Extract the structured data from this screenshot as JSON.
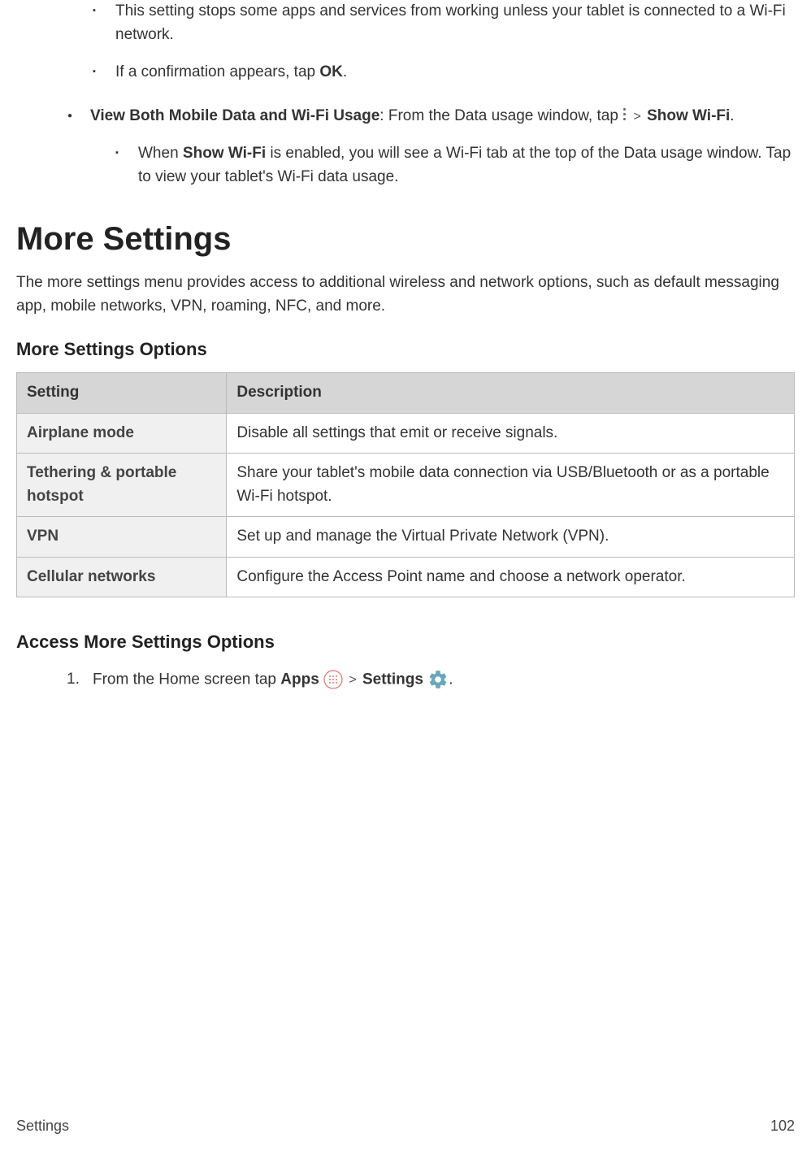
{
  "intro_sub_bullets": [
    "This setting stops some apps and services from working unless your tablet is connected to a Wi-Fi network.",
    "If a confirmation appears, tap "
  ],
  "ok_label": "OK",
  "view_both": {
    "lead_bold": "View Both Mobile Data and Wi-Fi Usage",
    "lead_rest": ": From the Data usage window, tap ",
    "gt": ">",
    "show_wifi": "Show Wi-Fi",
    "sub": "When ",
    "sub_bold": "Show Wi-Fi",
    "sub_rest": " is enabled, you will see a Wi-Fi tab at the top of the Data usage window. Tap to view your tablet's Wi-Fi data usage."
  },
  "h1": "More Settings",
  "intro_para": "The more settings menu provides access to additional wireless and network options, such as default messaging app, mobile networks, VPN, roaming, NFC, and more.",
  "h2_options": "More Settings Options",
  "table": {
    "headers": [
      "Setting",
      "Description"
    ],
    "rows": [
      [
        "Airplane mode",
        "Disable all settings that emit or receive signals."
      ],
      [
        "Tethering & portable hotspot",
        "Share your tablet's mobile data connection via USB/Bluetooth or as a portable Wi-Fi hotspot."
      ],
      [
        "VPN",
        "Set up and manage the Virtual Private Network (VPN)."
      ],
      [
        "Cellular networks",
        "Configure the Access Point name and choose a network operator."
      ]
    ]
  },
  "h2_access": "Access More Settings Options",
  "step1": {
    "num": "1.",
    "pre": "From the Home screen tap ",
    "apps": "Apps",
    "gt": ">",
    "settings": "Settings",
    "post": "."
  },
  "footer": {
    "left": "Settings",
    "right": "102"
  }
}
